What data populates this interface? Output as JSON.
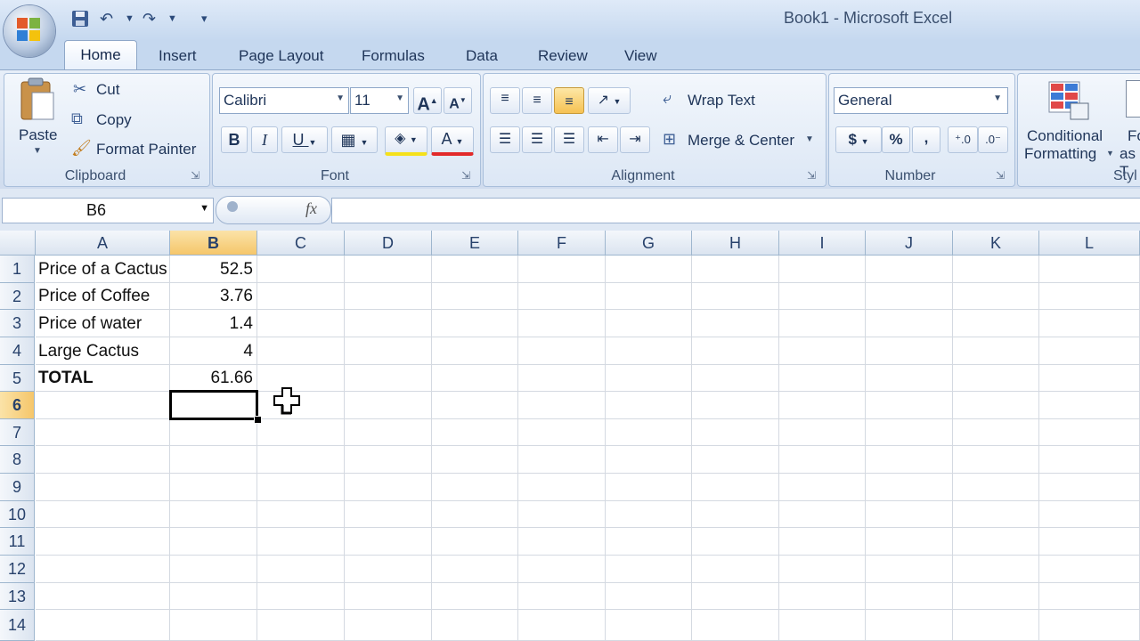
{
  "window": {
    "title": "Book1 - Microsoft Excel"
  },
  "tabs": [
    "Home",
    "Insert",
    "Page Layout",
    "Formulas",
    "Data",
    "Review",
    "View"
  ],
  "clipboard": {
    "paste": "Paste",
    "cut": "Cut",
    "copy": "Copy",
    "format_painter": "Format Painter",
    "group": "Clipboard"
  },
  "font": {
    "name": "Calibri",
    "size": "11",
    "bold": "B",
    "italic": "I",
    "underline": "U",
    "group": "Font"
  },
  "alignment": {
    "wrap_text": "Wrap Text",
    "merge_center": "Merge & Center",
    "group": "Alignment"
  },
  "number": {
    "format": "General",
    "currency": "$",
    "percent": "%",
    "comma": ",",
    "group": "Number"
  },
  "styles": {
    "conditional": "Conditional",
    "formatting": "Formatting",
    "format_as_1": "Fo",
    "format_as_2": "as T",
    "group": "Styl"
  },
  "formula_bar": {
    "name_box": "B6",
    "fx": "fx",
    "value": ""
  },
  "columns": [
    "A",
    "B",
    "C",
    "D",
    "E",
    "F",
    "G",
    "H",
    "I",
    "J",
    "K",
    "L"
  ],
  "rows": [
    "1",
    "2",
    "3",
    "4",
    "5",
    "6",
    "7",
    "8",
    "9",
    "10",
    "11",
    "12",
    "13",
    "14"
  ],
  "cells": {
    "A1": "Price of a Cactus",
    "B1": "52.5",
    "A2": "Price of Coffee",
    "B2": "3.76",
    "A3": "Price of water",
    "B3": "1.4",
    "A4": "Large Cactus",
    "B4": "4",
    "A5": "TOTAL",
    "B5": "61.66"
  },
  "active_cell": "B6",
  "colors": {
    "selection": "#000000",
    "active_header": "#f8d48f",
    "ribbon": "#dce7f5"
  }
}
